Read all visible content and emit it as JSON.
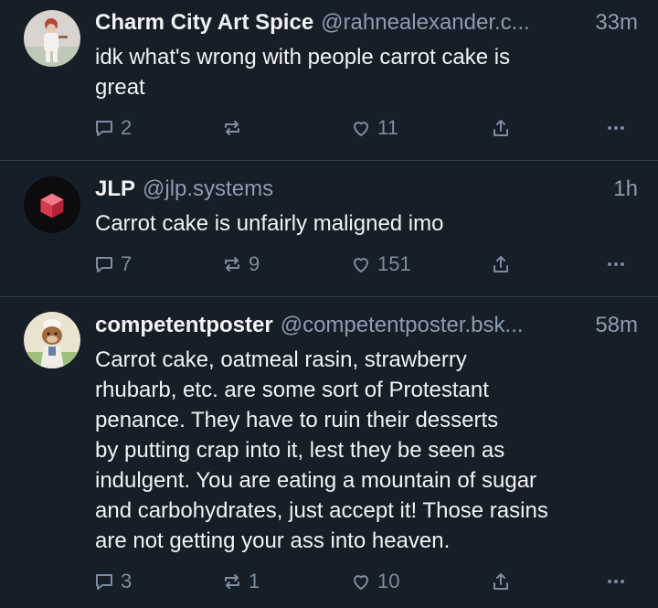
{
  "posts": [
    {
      "author_name": "Charm City Art Spice",
      "handle": "@rahnealexander.c...",
      "time": "33m",
      "text": "idk what's wrong with people carrot cake is\ngreat",
      "replies": "2",
      "reposts": "",
      "likes": "11"
    },
    {
      "author_name": "JLP",
      "handle": "@jlp.systems",
      "time": "1h",
      "text": "Carrot cake is unfairly maligned imo",
      "replies": "7",
      "reposts": "9",
      "likes": "151"
    },
    {
      "author_name": "competentposter",
      "handle": "@competentposter.bsk...",
      "time": "58m",
      "text": "Carrot cake, oatmeal rasin, strawberry\nrhubarb, etc. are some sort of Protestant\npenance. They have to ruin their desserts\nby putting crap into it, lest they be seen as\nindulgent. You are eating a mountain of sugar\nand carbohydrates, just accept it! Those rasins\nare not getting your ass into heaven.",
      "replies": "3",
      "reposts": "1",
      "likes": "10"
    }
  ],
  "colors": {
    "background": "#161e27",
    "divider": "#2e4052",
    "muted": "#8c9db0",
    "icon": "#7b8da1"
  },
  "icons": [
    "reply-icon",
    "repost-icon",
    "like-icon",
    "share-icon",
    "more-icon"
  ]
}
